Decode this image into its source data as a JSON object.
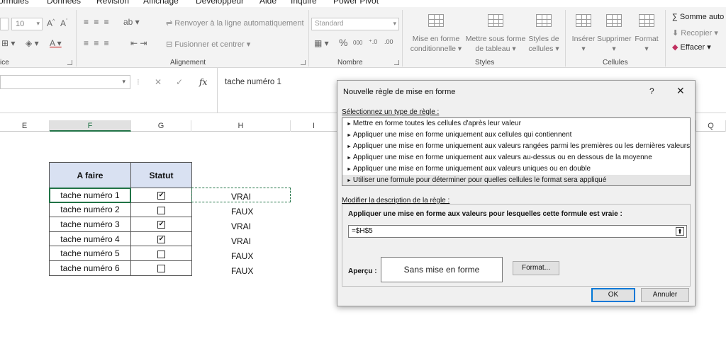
{
  "menu_tabs": [
    "ormules",
    "Données",
    "Révision",
    "Affichage",
    "Développeur",
    "Aide",
    "Inquire",
    "Power Pivot"
  ],
  "ribbon": {
    "font_size": "10",
    "wrap_text": "Renvoyer à la ligne automatiquement",
    "merge_center": "Fusionner et centrer",
    "number_format": "Standard",
    "groups": {
      "font": "ice",
      "alignment": "Alignement",
      "number": "Nombre",
      "styles": "Styles",
      "cells": "Cellules"
    },
    "styles": {
      "conditional_1": "Mise en forme",
      "conditional_2": "conditionnelle",
      "table_1": "Mettre sous forme",
      "table_2": "de tableau",
      "cell_1": "Styles de",
      "cell_2": "cellules"
    },
    "cells": {
      "insert": "Insérer",
      "delete": "Supprimer",
      "format": "Format"
    },
    "editing": {
      "autosum": "Somme auto",
      "fill": "Recopier",
      "clear": "Effacer"
    }
  },
  "formula_bar": {
    "content": "tache numéro 1"
  },
  "columns": [
    "E",
    "F",
    "G",
    "H",
    "I",
    "Q"
  ],
  "sheet": {
    "headers": [
      "A faire",
      "Statut"
    ],
    "rows": [
      {
        "task": "tache numéro 1",
        "checked": true,
        "value": "VRAI"
      },
      {
        "task": "tache numéro 2",
        "checked": false,
        "value": "FAUX"
      },
      {
        "task": "tache numéro 3",
        "checked": true,
        "value": "VRAI"
      },
      {
        "task": "tache numéro 4",
        "checked": true,
        "value": "VRAI"
      },
      {
        "task": "tache numéro 5",
        "checked": false,
        "value": "FAUX"
      },
      {
        "task": "tache numéro 6",
        "checked": false,
        "value": "FAUX"
      }
    ]
  },
  "dialog": {
    "title": "Nouvelle règle de mise en forme",
    "help": "?",
    "close": "✕",
    "select_type_label": "Sélectionnez un type de règle :",
    "rule_types": [
      "Mettre en forme toutes les cellules d'après leur valeur",
      "Appliquer une mise en forme uniquement aux cellules qui contiennent",
      "Appliquer une mise en forme uniquement aux valeurs rangées parmi les premières ou les dernières valeurs",
      "Appliquer une mise en forme uniquement aux valeurs au-dessus ou en dessous de la moyenne",
      "Appliquer une mise en forme uniquement aux valeurs uniques ou en double",
      "Utiliser une formule pour déterminer pour quelles cellules le format sera appliqué"
    ],
    "selected_rule_index": 5,
    "edit_desc_label": "Modifier la description de la règle :",
    "formula_heading": "Appliquer une mise en forme aux valeurs pour lesquelles cette formule est vraie :",
    "formula_value": "=$H$5",
    "preview_label": "Aperçu :",
    "preview_text": "Sans mise en forme",
    "format_button": "Format...",
    "ok_button": "OK",
    "cancel_button": "Annuler"
  }
}
